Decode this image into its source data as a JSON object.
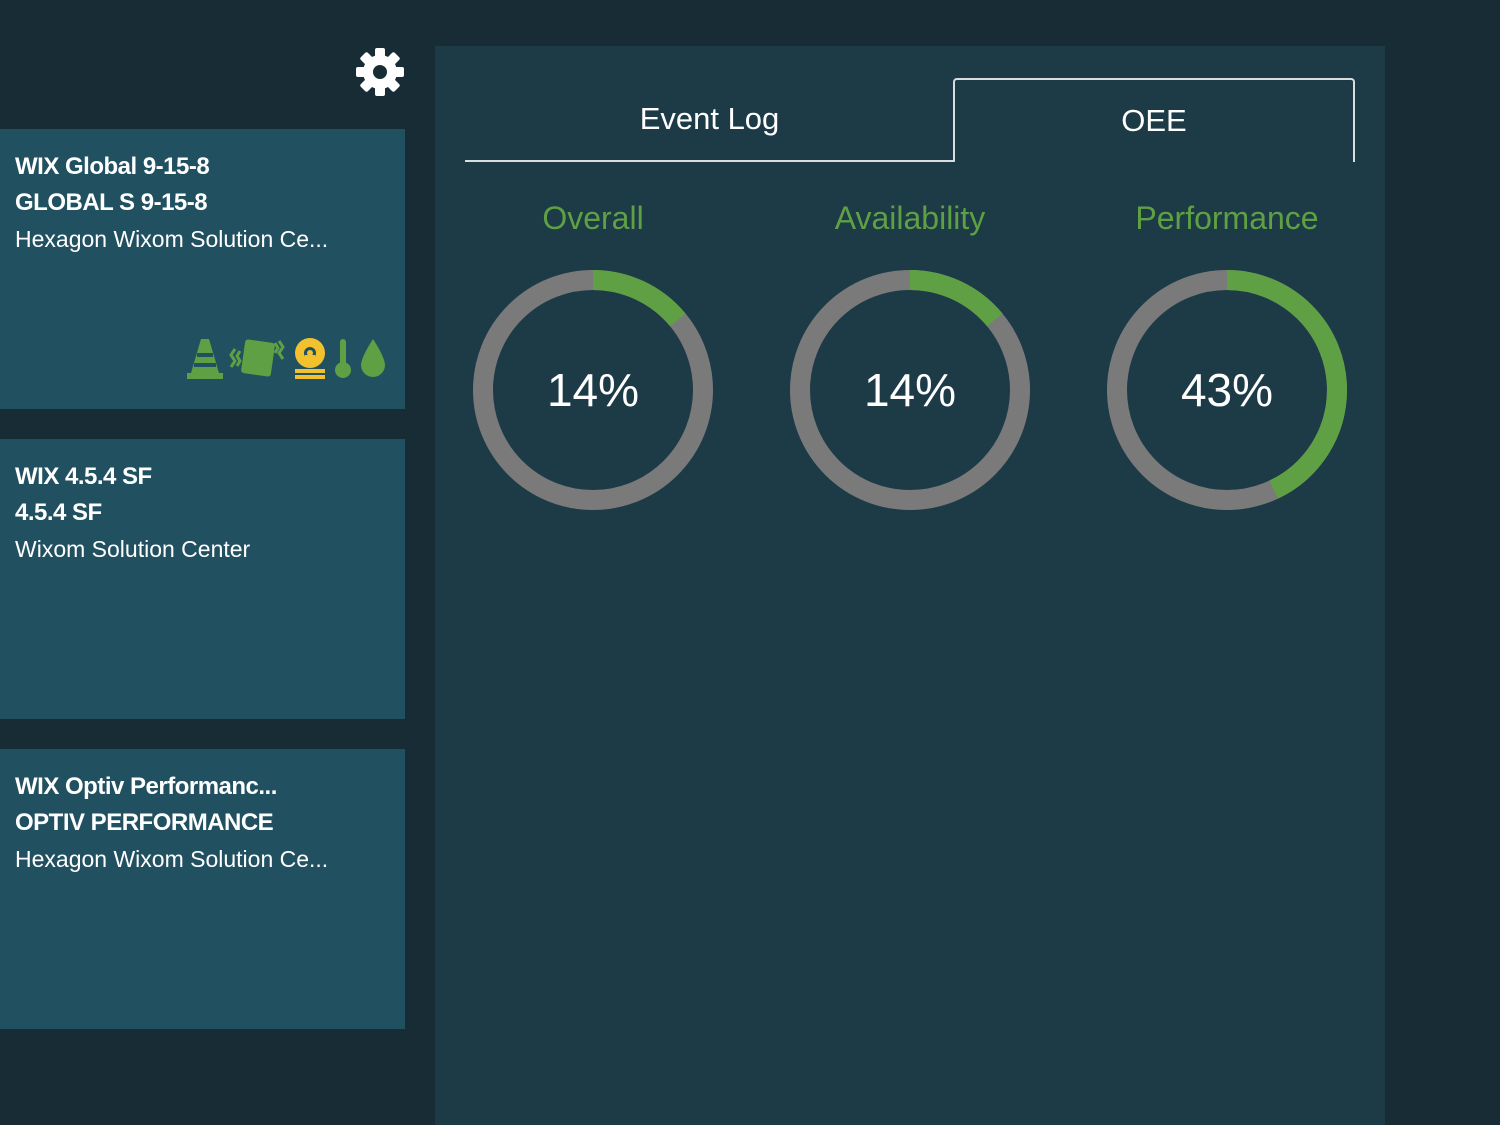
{
  "sidebar": {
    "settings_icon": "gear-icon",
    "cards": [
      {
        "line1": "WIX Global 9-15-8",
        "line2": "GLOBAL S 9-15-8",
        "line3": "Hexagon Wixom Solution Ce...",
        "status_icons": [
          "cone-icon",
          "vibration-icon",
          "operator-icon",
          "thermometer-icon",
          "droplet-icon"
        ]
      },
      {
        "line1": "WIX 4.5.4 SF",
        "line2": "4.5.4 SF",
        "line3": "Wixom Solution Center",
        "status_icons": []
      },
      {
        "line1": "WIX Optiv Performanc...",
        "line2": "OPTIV PERFORMANCE",
        "line3": "Hexagon Wixom Solution Ce...",
        "status_icons": []
      }
    ]
  },
  "tabs": [
    {
      "label": "Event Log",
      "active": false
    },
    {
      "label": "OEE",
      "active": true
    }
  ],
  "gauges": [
    {
      "title": "Overall",
      "value_text": "14%",
      "fraction": 0.14
    },
    {
      "title": "Availability",
      "value_text": "14%",
      "fraction": 0.14
    },
    {
      "title": "Performance",
      "value_text": "43%",
      "fraction": 0.43
    }
  ],
  "colors": {
    "background": "#172c34",
    "card": "#215060",
    "panel": "#1d3b47",
    "accent_green": "#5ea043",
    "gauge_track": "#7a7a7a",
    "warning_yellow": "#f2c12e"
  }
}
